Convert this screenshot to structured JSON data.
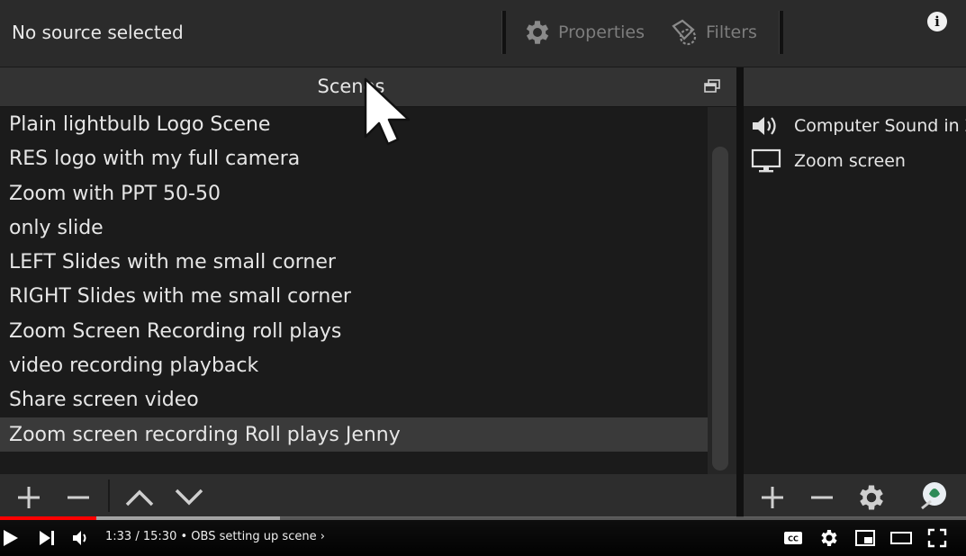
{
  "toolbar": {
    "no_source_label": "No source selected",
    "properties_label": "Properties",
    "filters_label": "Filters"
  },
  "scenes": {
    "title": "Scenes",
    "items": [
      "Plain lightbulb Logo Scene",
      "RES logo with my full camera",
      "Zoom with PPT 50-50",
      "only slide",
      "LEFT Slides with me small corner",
      "RIGHT Slides with me small corner",
      "Zoom Screen Recording  roll plays",
      "video recording playback",
      "Share screen video",
      "Zoom screen recording Roll plays Jenny"
    ],
    "selected_index": 9
  },
  "sources": {
    "items": [
      {
        "label": "Computer Sound in Zoom",
        "icon": "speaker-icon"
      },
      {
        "label": "Zoom screen",
        "icon": "monitor-icon"
      }
    ]
  },
  "player": {
    "current_time": "1:33",
    "duration": "15:30",
    "separator": "/",
    "dot": "•",
    "video_title": "OBS setting up scene",
    "played_fraction": 0.1,
    "loaded_fraction": 0.29
  },
  "colors": {
    "accent_red": "#ff0000",
    "panel_bg": "#1b1b1b",
    "header_bg": "#333333"
  }
}
